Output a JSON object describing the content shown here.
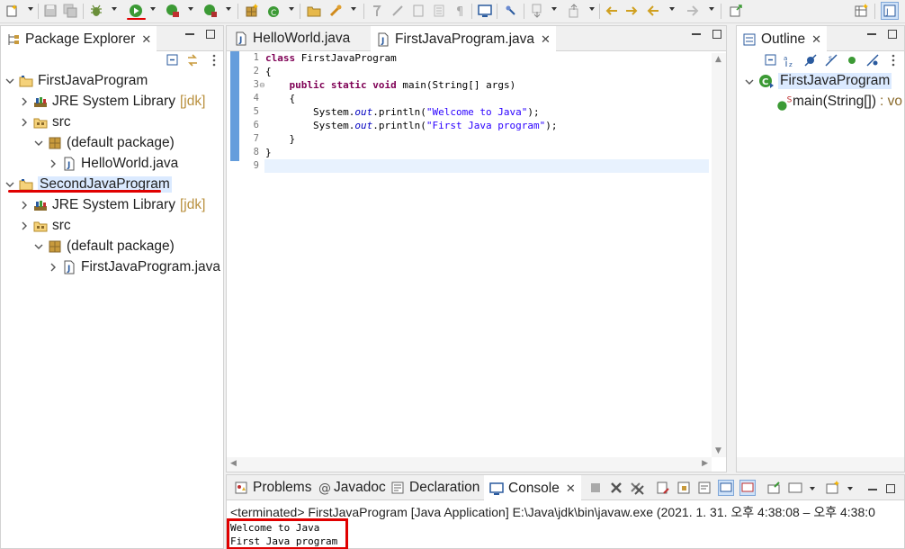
{
  "toolbar": {
    "icons": [
      "new-wizard-icon",
      "save-icon",
      "save-all-icon",
      "debug-icon",
      "run-icon",
      "coverage-icon",
      "external-tools-icon",
      "new-java-package-icon",
      "new-java-class-icon",
      "open-type-icon",
      "search-icon",
      "toggle-mark-occurrences-icon",
      "toggle-block-selection-icon",
      "show-whitespace-icon",
      "open-console-icon",
      "pin-editor-icon",
      "next-annotation-icon",
      "previous-annotation-icon",
      "last-edit-location-icon",
      "back-icon",
      "forward-icon",
      "maximize-icon",
      "open-perspective-icon",
      "java-perspective-icon"
    ]
  },
  "package_explorer": {
    "title": "Package Explorer",
    "items": [
      {
        "label": "FirstJavaProgram",
        "icon": "project-icon"
      },
      {
        "label": "JRE System Library",
        "decoration": "[jdk]",
        "icon": "library-icon"
      },
      {
        "label": "src",
        "icon": "source-folder-icon"
      },
      {
        "label": "(default package)",
        "icon": "package-icon"
      },
      {
        "label": "HelloWorld.java",
        "icon": "java-file-icon"
      },
      {
        "label": "SecondJavaProgram",
        "icon": "project-icon"
      },
      {
        "label": "JRE System Library",
        "decoration": "[jdk]",
        "icon": "library-icon"
      },
      {
        "label": "src",
        "icon": "source-folder-icon"
      },
      {
        "label": "(default package)",
        "icon": "package-icon"
      },
      {
        "label": "FirstJavaProgram.java",
        "icon": "java-file-icon"
      }
    ]
  },
  "editor": {
    "tabs": [
      {
        "label": "HelloWorld.java"
      },
      {
        "label": "FirstJavaProgram.java"
      }
    ],
    "line_numbers": [
      "1",
      "2",
      "3",
      "4",
      "5",
      "6",
      "7",
      "8",
      "9"
    ],
    "code": {
      "l1_kw": "class",
      "l1_rest": " FirstJavaProgram",
      "l2": "{",
      "l3_indent": "    ",
      "l3_kw1": "public",
      "l3_kw2": "static",
      "l3_kw3": "void",
      "l3_rest": " main(String[] args)",
      "l4": "    {",
      "l5_a": "        System.",
      "l5_field": "out",
      "l5_b": ".println(",
      "l5_str": "\"Welcome to Java\"",
      "l5_c": ");",
      "l6_a": "        System.",
      "l6_field": "out",
      "l6_b": ".println(",
      "l6_str": "\"First Java program\"",
      "l6_c": ");",
      "l7": "    }",
      "l8": "}",
      "l9": ""
    }
  },
  "outline": {
    "title": "Outline",
    "items": [
      {
        "label": "FirstJavaProgram",
        "icon": "class-icon"
      },
      {
        "label": "main(String[])",
        "suffix": ": vo",
        "icon": "method-icon"
      }
    ]
  },
  "console": {
    "tabs": [
      {
        "label": "Problems",
        "icon": "problems-icon"
      },
      {
        "label": "Javadoc",
        "icon": "javadoc-icon"
      },
      {
        "label": "Declaration",
        "icon": "declaration-icon"
      },
      {
        "label": "Console",
        "icon": "console-icon"
      }
    ],
    "header": "<terminated> FirstJavaProgram [Java Application] E:\\Java\\jdk\\bin\\javaw.exe  (2021. 1. 31. 오후 4:38:08 – 오후 4:38:0",
    "output": [
      "Welcome to Java",
      "First Java program"
    ]
  },
  "colors": {
    "keyword": "#7f0055",
    "string": "#2a00ff",
    "field": "#0000c0",
    "annotation_red": "#e00000",
    "selection": "#dbeaff",
    "decoration": "#b9903e"
  }
}
